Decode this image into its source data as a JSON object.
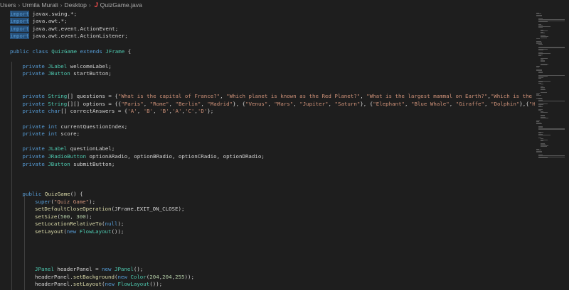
{
  "breadcrumb": {
    "parts": [
      "Users",
      "Urmila Murali",
      "Desktop"
    ],
    "file_icon": "J",
    "file_name": "QuizGame.java"
  },
  "code_lines": [
    {
      "row": 0,
      "indent": 0,
      "tokens": [
        {
          "t": "import",
          "c": "hl kw"
        },
        {
          "t": " javax.swing.*;"
        }
      ]
    },
    {
      "row": 1,
      "indent": 0,
      "tokens": [
        {
          "t": "import",
          "c": "hl kw"
        },
        {
          "t": " java.awt.*;"
        }
      ]
    },
    {
      "row": 2,
      "indent": 0,
      "tokens": [
        {
          "t": "import",
          "c": "hl kw"
        },
        {
          "t": " java.awt.event.ActionEvent;"
        }
      ]
    },
    {
      "row": 3,
      "indent": 0,
      "tokens": [
        {
          "t": "import",
          "c": "hl kw"
        },
        {
          "t": " java.awt.event.ActionListener;"
        }
      ]
    },
    {
      "row": 5,
      "indent": 0,
      "tokens": [
        {
          "t": "public class ",
          "c": "kw"
        },
        {
          "t": "QuizGame",
          "c": "ty"
        },
        {
          "t": " extends ",
          "c": "kw"
        },
        {
          "t": "JFrame",
          "c": "ty"
        },
        {
          "t": " {"
        }
      ]
    },
    {
      "row": 7,
      "indent": 1,
      "tokens": [
        {
          "t": "private ",
          "c": "kw"
        },
        {
          "t": "JLabel",
          "c": "ty"
        },
        {
          "t": " welcomeLabel;"
        }
      ]
    },
    {
      "row": 8,
      "indent": 1,
      "tokens": [
        {
          "t": "private ",
          "c": "kw"
        },
        {
          "t": "JButton",
          "c": "ty"
        },
        {
          "t": " startButton;"
        }
      ]
    },
    {
      "row": 11,
      "indent": 1,
      "tokens": [
        {
          "t": "private ",
          "c": "kw"
        },
        {
          "t": "String",
          "c": "ty"
        },
        {
          "t": "[] questions = {"
        },
        {
          "t": "\"What is the capital of France?\"",
          "c": "st"
        },
        {
          "t": ", "
        },
        {
          "t": "\"Which planet is known as the Red Planet?\"",
          "c": "st"
        },
        {
          "t": ", "
        },
        {
          "t": "\"What is the largest mammal on Earth?\"",
          "c": "st"
        },
        {
          "t": ","
        },
        {
          "t": "\"Which is the natio",
          "c": "st"
        }
      ]
    },
    {
      "row": 12,
      "indent": 1,
      "tokens": [
        {
          "t": "private ",
          "c": "kw"
        },
        {
          "t": "String",
          "c": "ty"
        },
        {
          "t": "[][] options = {{"
        },
        {
          "t": "\"Paris\"",
          "c": "st"
        },
        {
          "t": ", "
        },
        {
          "t": "\"Rome\"",
          "c": "st"
        },
        {
          "t": ", "
        },
        {
          "t": "\"Berlin\"",
          "c": "st"
        },
        {
          "t": ", "
        },
        {
          "t": "\"Madrid\"",
          "c": "st"
        },
        {
          "t": "}, {"
        },
        {
          "t": "\"Venus\"",
          "c": "st"
        },
        {
          "t": ", "
        },
        {
          "t": "\"Mars\"",
          "c": "st"
        },
        {
          "t": ", "
        },
        {
          "t": "\"Jupiter\"",
          "c": "st"
        },
        {
          "t": ", "
        },
        {
          "t": "\"Saturn\"",
          "c": "st"
        },
        {
          "t": "}, {"
        },
        {
          "t": "\"Elephant\"",
          "c": "st"
        },
        {
          "t": ", "
        },
        {
          "t": "\"Blue Whale\"",
          "c": "st"
        },
        {
          "t": ", "
        },
        {
          "t": "\"Giraffe\"",
          "c": "st"
        },
        {
          "t": ", "
        },
        {
          "t": "\"Dolphin\"",
          "c": "st"
        },
        {
          "t": "},{"
        },
        {
          "t": "\"Hockey",
          "c": "st"
        }
      ]
    },
    {
      "row": 13,
      "indent": 1,
      "tokens": [
        {
          "t": "private ",
          "c": "kw"
        },
        {
          "t": "char",
          "c": "kw"
        },
        {
          "t": "[] correctAnswers = {"
        },
        {
          "t": "'A'",
          "c": "st"
        },
        {
          "t": ", "
        },
        {
          "t": "'B'",
          "c": "st"
        },
        {
          "t": ", "
        },
        {
          "t": "'B'",
          "c": "st"
        },
        {
          "t": ","
        },
        {
          "t": "'A'",
          "c": "st"
        },
        {
          "t": ","
        },
        {
          "t": "'C'",
          "c": "st"
        },
        {
          "t": ","
        },
        {
          "t": "'D'",
          "c": "st"
        },
        {
          "t": "};"
        }
      ]
    },
    {
      "row": 15,
      "indent": 1,
      "tokens": [
        {
          "t": "private ",
          "c": "kw"
        },
        {
          "t": "int",
          "c": "kw"
        },
        {
          "t": " currentQuestionIndex;"
        }
      ]
    },
    {
      "row": 16,
      "indent": 1,
      "tokens": [
        {
          "t": "private ",
          "c": "kw"
        },
        {
          "t": "int",
          "c": "kw"
        },
        {
          "t": " score;"
        }
      ]
    },
    {
      "row": 18,
      "indent": 1,
      "tokens": [
        {
          "t": "private ",
          "c": "kw"
        },
        {
          "t": "JLabel",
          "c": "ty"
        },
        {
          "t": " questionLabel;"
        }
      ]
    },
    {
      "row": 19,
      "indent": 1,
      "tokens": [
        {
          "t": "private ",
          "c": "kw"
        },
        {
          "t": "JRadioButton",
          "c": "ty"
        },
        {
          "t": " optionARadio, optionBRadio, optionCRadio, optionDRadio;"
        }
      ]
    },
    {
      "row": 20,
      "indent": 1,
      "tokens": [
        {
          "t": "private ",
          "c": "kw"
        },
        {
          "t": "JButton",
          "c": "ty"
        },
        {
          "t": " submitButton;"
        }
      ]
    },
    {
      "row": 24,
      "indent": 1,
      "tokens": [
        {
          "t": "public ",
          "c": "kw"
        },
        {
          "t": "QuizGame",
          "c": "fn"
        },
        {
          "t": "() {"
        }
      ]
    },
    {
      "row": 25,
      "indent": 2,
      "tokens": [
        {
          "t": "super",
          "c": "kw"
        },
        {
          "t": "("
        },
        {
          "t": "\"Quiz Game\"",
          "c": "st"
        },
        {
          "t": ");"
        }
      ]
    },
    {
      "row": 26,
      "indent": 2,
      "tokens": [
        {
          "t": "setDefaultCloseOperation",
          "c": "fn"
        },
        {
          "t": "(JFrame.EXIT_ON_CLOSE);"
        }
      ]
    },
    {
      "row": 27,
      "indent": 2,
      "tokens": [
        {
          "t": "setSize",
          "c": "fn"
        },
        {
          "t": "("
        },
        {
          "t": "500",
          "c": "nu"
        },
        {
          "t": ", "
        },
        {
          "t": "300",
          "c": "nu"
        },
        {
          "t": ");"
        }
      ]
    },
    {
      "row": 28,
      "indent": 2,
      "tokens": [
        {
          "t": "setLocationRelativeTo",
          "c": "fn"
        },
        {
          "t": "("
        },
        {
          "t": "null",
          "c": "kw"
        },
        {
          "t": ");"
        }
      ]
    },
    {
      "row": 29,
      "indent": 2,
      "tokens": [
        {
          "t": "setLayout",
          "c": "fn"
        },
        {
          "t": "("
        },
        {
          "t": "new ",
          "c": "kw"
        },
        {
          "t": "FlowLayout",
          "c": "ty"
        },
        {
          "t": "());"
        }
      ]
    },
    {
      "row": 34,
      "indent": 2,
      "tokens": [
        {
          "t": "JPanel",
          "c": "ty"
        },
        {
          "t": " headerPanel = "
        },
        {
          "t": "new ",
          "c": "kw"
        },
        {
          "t": "JPanel",
          "c": "ty"
        },
        {
          "t": "();"
        }
      ]
    },
    {
      "row": 35,
      "indent": 2,
      "tokens": [
        {
          "t": "headerPanel."
        },
        {
          "t": "setBackground",
          "c": "fn"
        },
        {
          "t": "("
        },
        {
          "t": "new ",
          "c": "kw"
        },
        {
          "t": "Color",
          "c": "ty"
        },
        {
          "t": "("
        },
        {
          "t": "204",
          "c": "nu"
        },
        {
          "t": ","
        },
        {
          "t": "204",
          "c": "nu"
        },
        {
          "t": ","
        },
        {
          "t": "255",
          "c": "nu"
        },
        {
          "t": "));"
        }
      ]
    },
    {
      "row": 36,
      "indent": 2,
      "tokens": [
        {
          "t": "headerPanel."
        },
        {
          "t": "setLayout",
          "c": "fn"
        },
        {
          "t": "("
        },
        {
          "t": "new ",
          "c": "kw"
        },
        {
          "t": "FlowLayout",
          "c": "ty"
        },
        {
          "t": "());"
        }
      ]
    }
  ]
}
